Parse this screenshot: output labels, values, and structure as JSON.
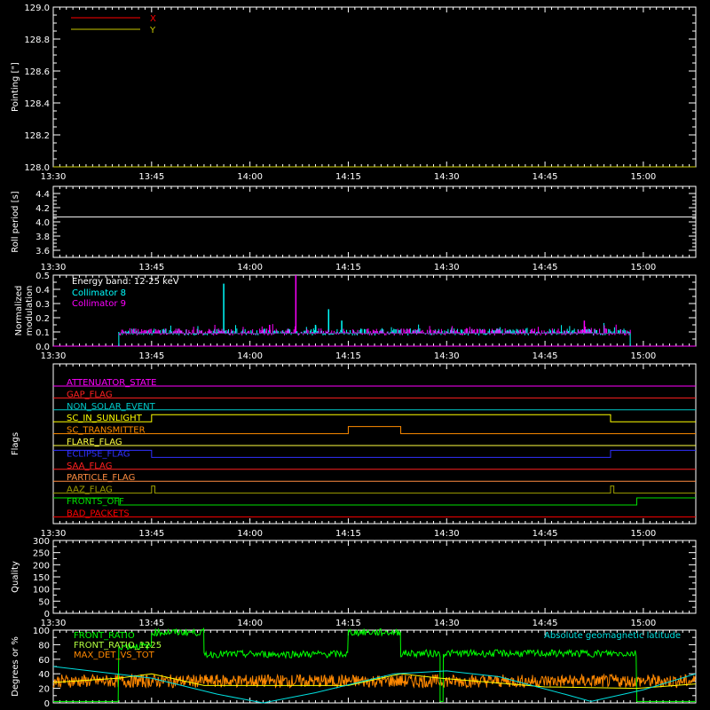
{
  "time_axis": {
    "start": "13:30",
    "end": "15:08",
    "tick_labels": [
      "13:30",
      "13:45",
      "14:00",
      "14:15",
      "14:30",
      "14:45",
      "15:00"
    ]
  },
  "chart_data": [
    {
      "type": "line",
      "ylabel": "Pointing [\"]",
      "ylim": [
        128.0,
        129.0
      ],
      "yticks": [
        "128.0",
        "128.2",
        "128.4",
        "128.6",
        "128.8",
        "129.0"
      ],
      "legend_placement": "top-left",
      "series": [
        {
          "name": "X",
          "color": "#ff0000",
          "points": [
            [
              "13:30",
              128.0
            ],
            [
              "15:08",
              128.0
            ]
          ]
        },
        {
          "name": "Y",
          "color": "#c8c800",
          "points": [
            [
              "13:30",
              128.0
            ],
            [
              "15:08",
              128.0
            ]
          ]
        }
      ]
    },
    {
      "type": "line",
      "ylabel": "Roll period [s]",
      "ylim": [
        3.5,
        4.5
      ],
      "yticks": [
        "3.6",
        "3.8",
        "4.0",
        "4.2",
        "4.4"
      ],
      "series": [
        {
          "color": "#ffffff",
          "points": [
            [
              "13:30",
              4.07
            ],
            [
              "15:08",
              4.07
            ]
          ]
        }
      ]
    },
    {
      "type": "bar",
      "ylabel": "Normalized modulation",
      "ylim": [
        0.0,
        0.5
      ],
      "yticks": [
        "0.0",
        "0.1",
        "0.2",
        "0.3",
        "0.4",
        "0.5"
      ],
      "annotation": "Energy band: 12-25 keV",
      "data_start": "13:40",
      "data_end": "14:58",
      "typical_level": 0.1,
      "series": [
        {
          "name": "Collimator 8",
          "color": "#00ffff",
          "peaks": [
            [
              "13:56",
              0.44
            ],
            [
              "14:10",
              0.15
            ],
            [
              "14:12",
              0.26
            ],
            [
              "14:14",
              0.18
            ]
          ]
        },
        {
          "name": "Collimator 9",
          "color": "#ff00ff",
          "peaks": [
            [
              "14:07",
              0.5
            ],
            [
              "14:03",
              0.15
            ],
            [
              "14:51",
              0.18
            ]
          ]
        }
      ]
    },
    {
      "type": "line",
      "ylabel": "Flags",
      "flags": [
        {
          "name": "ATTENUATOR_STATE",
          "color": "#ff00ff",
          "steps": []
        },
        {
          "name": "GAP_FLAG",
          "color": "#ff2020",
          "steps": []
        },
        {
          "name": "NON_SOLAR_EVENT",
          "color": "#00c8c8",
          "steps": []
        },
        {
          "name": "SC_IN_SUNLIGHT",
          "color": "#ffff00",
          "steps": [
            [
              "13:30",
              0
            ],
            [
              "13:45",
              1
            ],
            [
              "14:55",
              0
            ],
            [
              "15:08",
              0
            ]
          ]
        },
        {
          "name": "SC_TRANSMITTER",
          "color": "#ff8c00",
          "steps": [
            [
              "13:30",
              0
            ],
            [
              "14:15",
              1
            ],
            [
              "14:23",
              0
            ],
            [
              "15:08",
              0
            ]
          ]
        },
        {
          "name": "FLARE_FLAG",
          "color": "#ffff40",
          "steps": []
        },
        {
          "name": "ECLIPSE_FLAG",
          "color": "#3030ff",
          "steps": [
            [
              "13:30",
              1
            ],
            [
              "13:45",
              0
            ],
            [
              "14:55",
              1
            ],
            [
              "15:08",
              1
            ]
          ]
        },
        {
          "name": "SAA_FLAG",
          "color": "#ff2020",
          "steps": []
        },
        {
          "name": "PARTICLE_FLAG",
          "color": "#ff8c40",
          "steps": []
        },
        {
          "name": "AAZ_FLAG",
          "color": "#a0a000",
          "steps": [
            [
              "13:30",
              0
            ],
            [
              "13:45",
              1
            ],
            [
              "13:45.5",
              0
            ],
            [
              "14:55",
              1
            ],
            [
              "14:55.5",
              0
            ],
            [
              "15:08",
              0
            ]
          ]
        },
        {
          "name": "FRONTS_OFF",
          "color": "#00e000",
          "steps": [
            [
              "13:30",
              1
            ],
            [
              "13:40",
              0
            ],
            [
              "14:59",
              1
            ],
            [
              "15:08",
              1
            ]
          ]
        },
        {
          "name": "BAD_PACKETS",
          "color": "#ff0000",
          "steps": []
        }
      ]
    },
    {
      "type": "line",
      "ylabel": "Quality",
      "ylim": [
        0,
        300
      ],
      "yticks": [
        "0",
        "50",
        "100",
        "150",
        "200",
        "250",
        "300"
      ],
      "series": []
    },
    {
      "type": "line",
      "ylabel": "Degrees or %",
      "ylim": [
        0,
        100
      ],
      "yticks": [
        "0",
        "20",
        "40",
        "60",
        "80",
        "100"
      ],
      "annotation": "Absolute geomagnetic latitude",
      "annotation_color": "#00e0e0",
      "series": [
        {
          "name": "FRONT_RATIO",
          "color": "#00ff00",
          "segments": [
            [
              "13:30",
              "13:40",
              2
            ],
            [
              "13:40",
              "13:45",
              78
            ],
            [
              "13:45",
              "13:53",
              97
            ],
            [
              "13:53",
              "14:15",
              67
            ],
            [
              "14:15",
              "14:23",
              97
            ],
            [
              "14:23",
              "14:29",
              68
            ],
            [
              "14:29",
              "14:29.5",
              2
            ],
            [
              "14:29.5",
              "14:59",
              68
            ],
            [
              "14:59",
              "15:08",
              2
            ]
          ]
        },
        {
          "name": "FRONT_RATIO_1225",
          "color": "#b0ff40",
          "points": []
        },
        {
          "name": "MAX_DET_VS_TOT",
          "color": "#ff8800",
          "level": 30
        },
        {
          "name": "",
          "color": "#ffff00",
          "points": [
            [
              "13:30",
              28
            ],
            [
              "13:40",
              34
            ],
            [
              "13:45",
              40
            ],
            [
              "13:53",
              24
            ],
            [
              "14:05",
              24
            ],
            [
              "14:15",
              24
            ],
            [
              "14:23",
              40
            ],
            [
              "14:29",
              34
            ],
            [
              "14:45",
              22
            ],
            [
              "14:59",
              20
            ],
            [
              "15:08",
              26
            ]
          ]
        },
        {
          "name": "Absolute geomagnetic latitude",
          "color": "#00e0e0",
          "points": [
            [
              "13:30",
              50
            ],
            [
              "13:45",
              34
            ],
            [
              "13:55",
              12
            ],
            [
              "14:02",
              0
            ],
            [
              "14:10",
              14
            ],
            [
              "14:22",
              40
            ],
            [
              "14:30",
              44
            ],
            [
              "14:38",
              36
            ],
            [
              "14:48",
              12
            ],
            [
              "14:52",
              2
            ],
            [
              "15:00",
              18
            ],
            [
              "15:08",
              40
            ]
          ]
        }
      ]
    }
  ]
}
